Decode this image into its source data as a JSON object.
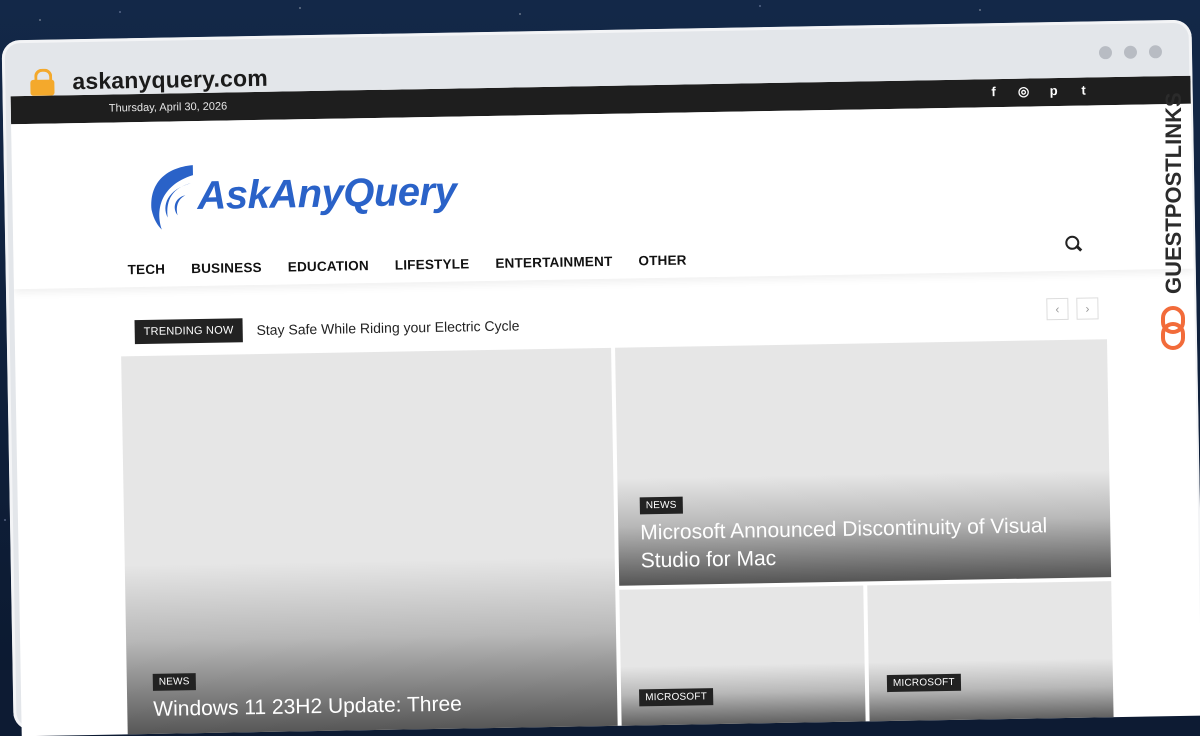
{
  "browser": {
    "url": "askanyquery.com",
    "icons": {
      "lock": "lock-icon",
      "window_dots": [
        "window-dot",
        "window-dot",
        "window-dot"
      ]
    },
    "accent_lock": "#f4a92c"
  },
  "topbar": {
    "date": "Thursday, April 30, 2026",
    "social_icons": [
      "facebook-icon",
      "instagram-icon",
      "pinterest-icon",
      "twitter-icon"
    ],
    "social_glyphs": [
      "f",
      "◎",
      "p",
      "t"
    ]
  },
  "header": {
    "logo_text": "AskAnyQuery",
    "brand_color": "#2a62c8",
    "nav": [
      "TECH",
      "BUSINESS",
      "EDUCATION",
      "LIFESTYLE",
      "ENTERTAINMENT",
      "OTHER"
    ],
    "search_icon": "search-icon"
  },
  "trending": {
    "label": "TRENDING NOW",
    "headline": "Stay Safe While Riding your Electric Cycle",
    "prev": "‹",
    "next": "›"
  },
  "cards": {
    "big": {
      "badge": "NEWS",
      "title": "Windows 11 23H2 Update: Three"
    },
    "right": {
      "badge": "NEWS",
      "title": "Microsoft Announced Discontinuity of Visual Studio for Mac"
    },
    "small1": {
      "badge": "MICROSOFT"
    },
    "small2": {
      "badge": "MICROSOFT"
    }
  },
  "watermark": {
    "text": "GUESTPOSTLINKS",
    "color": "#2b2b2b",
    "accent": "#f26b3a"
  }
}
